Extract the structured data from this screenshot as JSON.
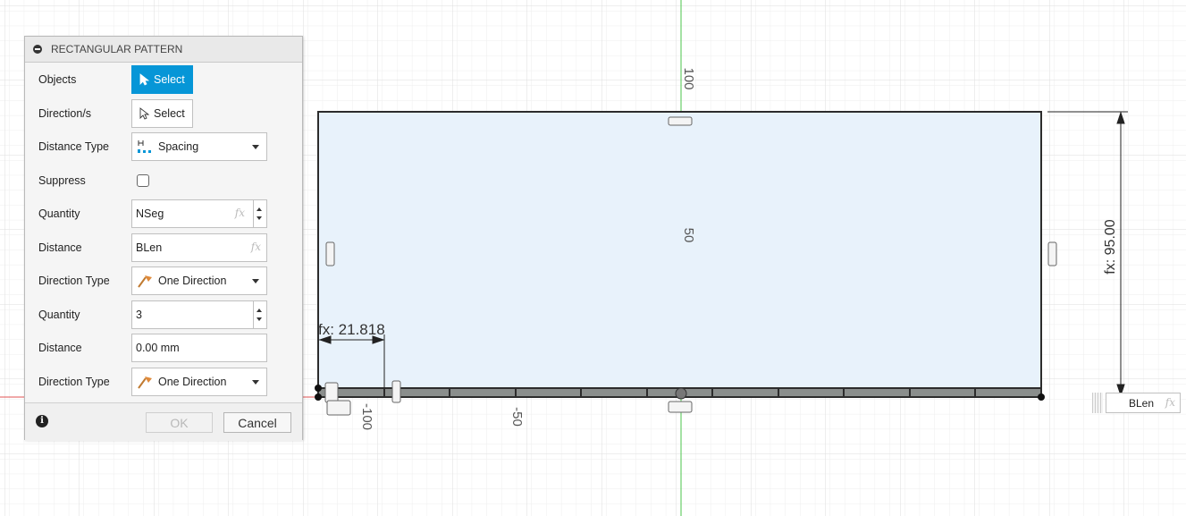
{
  "dialog": {
    "title": "RECTANGULAR PATTERN",
    "rows": {
      "objects": {
        "label": "Objects",
        "button": "Select"
      },
      "directions": {
        "label": "Direction/s",
        "button": "Select"
      },
      "distance_type": {
        "label": "Distance Type",
        "value": "Spacing"
      },
      "suppress": {
        "label": "Suppress",
        "checked": false
      },
      "quantity1": {
        "label": "Quantity",
        "value": "NSeg",
        "fx": "fx"
      },
      "distance1": {
        "label": "Distance",
        "value": "BLen",
        "fx": "fx"
      },
      "direction_type1": {
        "label": "Direction Type",
        "value": "One Direction"
      },
      "quantity2": {
        "label": "Quantity",
        "value": "3"
      },
      "distance2": {
        "label": "Distance",
        "value": "0.00 mm"
      },
      "direction_type2": {
        "label": "Direction Type",
        "value": "One Direction"
      }
    },
    "footer": {
      "ok": "OK",
      "cancel": "Cancel"
    }
  },
  "canvas": {
    "axis_labels": {
      "y100": "100",
      "y50": "50",
      "x_minus50": "-50",
      "x_minus100": "-100"
    },
    "dimensions": {
      "height": "fx: 95.00",
      "width": "fx: 21.818"
    },
    "dim_input": {
      "value": "BLen",
      "fx": "fx"
    }
  },
  "colors": {
    "accent": "#0696d7",
    "sketch_fill": "#e8f2fb",
    "x_axis": "#e05050",
    "y_axis": "#4bc44b"
  }
}
